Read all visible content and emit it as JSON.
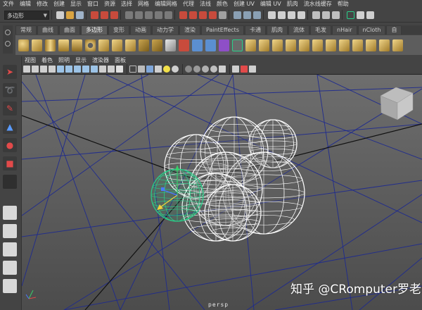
{
  "menubar": {
    "items": [
      "文件",
      "编辑",
      "修改",
      "创建",
      "显示",
      "窗口",
      "资源",
      "选择",
      "网格",
      "编辑网格",
      "代理",
      "法线",
      "颜色",
      "创建 UV",
      "编辑 UV",
      "肌肉",
      "流水线缓存",
      "帮助"
    ]
  },
  "statusline": {
    "mode_label": "多边形"
  },
  "shelf": {
    "tabs": [
      "常规",
      "曲线",
      "曲面",
      "多边形",
      "变形",
      "动画",
      "动力学",
      "渲染",
      "PaintEffects",
      "卡通",
      "肌肉",
      "流体",
      "毛发",
      "nHair",
      "nCloth",
      "自"
    ],
    "active_tab": "多边形"
  },
  "panel": {
    "menu": [
      "视图",
      "着色",
      "照明",
      "显示",
      "渲染器",
      "面板"
    ],
    "camera": "persp"
  },
  "watermark": "知乎 @CRomputer罗老师",
  "colors": {
    "accent_green": "#29d08a",
    "grid_blue": "#1e2a8f",
    "wireframe": "#ffffff"
  }
}
